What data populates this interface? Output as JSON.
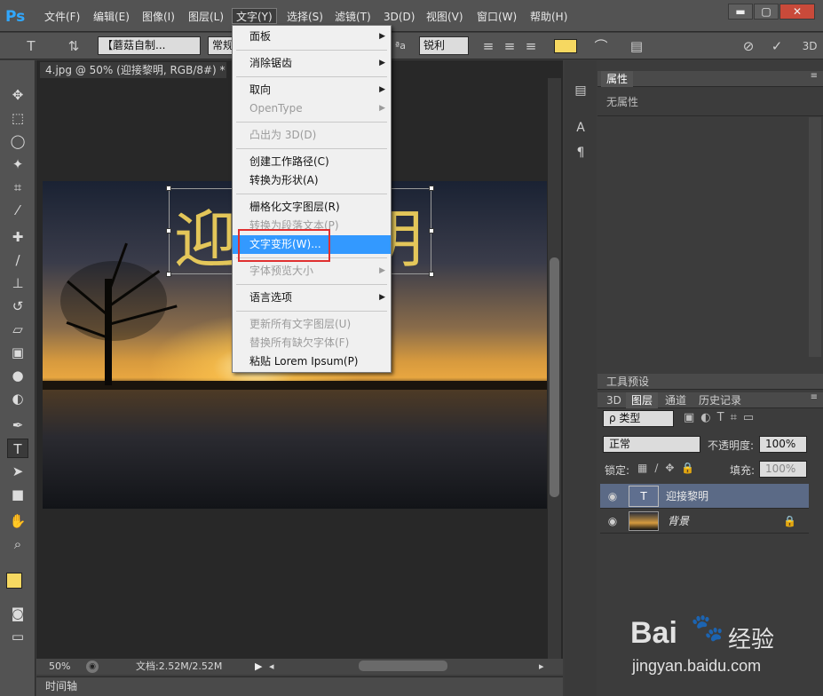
{
  "app": {
    "logo": "Ps"
  },
  "menubar": {
    "items": [
      "文件(F)",
      "编辑(E)",
      "图像(I)",
      "图层(L)",
      "文字(Y)",
      "选择(S)",
      "滤镜(T)",
      "3D(D)",
      "视图(V)",
      "窗口(W)",
      "帮助(H)"
    ],
    "active": "文字(Y)",
    "window_buttons": [
      "▬",
      "▢",
      "✕"
    ]
  },
  "options": {
    "font_family": "【蘑菇自制...",
    "font_style": "常规",
    "aa_label": "ªa",
    "aa_method": "锐利",
    "text_color": "#f6d861",
    "label_3d": "3D"
  },
  "document": {
    "tab_title": "4.jpg @ 50% (迎接黎明, RGB/8#) *",
    "canvas_text": "迎接黎明",
    "zoom": "50%",
    "doc_info": "文档:2.52M/2.52M"
  },
  "timeline": {
    "label": "时间轴"
  },
  "dropdown": {
    "items": [
      {
        "label": "面板",
        "submenu": true,
        "disabled": false
      },
      {
        "sep": true
      },
      {
        "label": "消除锯齿",
        "submenu": true,
        "disabled": false
      },
      {
        "sep": true
      },
      {
        "label": "取向",
        "submenu": true,
        "disabled": false
      },
      {
        "label": "OpenType",
        "submenu": true,
        "disabled": true
      },
      {
        "sep": true
      },
      {
        "label": "凸出为 3D(D)",
        "submenu": false,
        "disabled": true
      },
      {
        "sep": true
      },
      {
        "label": "创建工作路径(C)",
        "submenu": false,
        "disabled": false
      },
      {
        "label": "转换为形状(A)",
        "submenu": false,
        "disabled": false
      },
      {
        "sep": true
      },
      {
        "label": "栅格化文字图层(R)",
        "submenu": false,
        "disabled": false
      },
      {
        "label": "转换为段落文本(P)",
        "submenu": false,
        "disabled": true
      },
      {
        "label": "文字变形(W)...",
        "submenu": false,
        "disabled": false,
        "highlight": true
      },
      {
        "sep": true
      },
      {
        "label": "字体预览大小",
        "submenu": true,
        "disabled": true
      },
      {
        "sep": true
      },
      {
        "label": "语言选项",
        "submenu": true,
        "disabled": false
      },
      {
        "sep": true
      },
      {
        "label": "更新所有文字图层(U)",
        "submenu": false,
        "disabled": true
      },
      {
        "label": "替换所有缺欠字体(F)",
        "submenu": false,
        "disabled": true
      },
      {
        "label": "粘贴 Lorem Ipsum(P)",
        "submenu": false,
        "disabled": false
      }
    ]
  },
  "properties": {
    "tab": "属性",
    "empty_text": "无属性"
  },
  "tool_presets": {
    "tab": "工具预设"
  },
  "layers_panel": {
    "tabs": [
      "3D",
      "图层",
      "通道",
      "历史记录"
    ],
    "active_tab": "图层",
    "filter": "ρ 类型",
    "blend_mode": "正常",
    "opacity_label": "不透明度:",
    "opacity": "100%",
    "lock_label": "锁定:",
    "fill_label": "填充:",
    "fill": "100%",
    "layers": [
      {
        "name": "迎接黎明",
        "type": "text",
        "thumb": "T",
        "selected": true
      },
      {
        "name": "背景",
        "type": "image",
        "locked": true,
        "selected": false
      }
    ]
  },
  "watermark": {
    "brand": "Bai",
    "brand2": "经验",
    "url": "jingyan.baidu.com"
  }
}
